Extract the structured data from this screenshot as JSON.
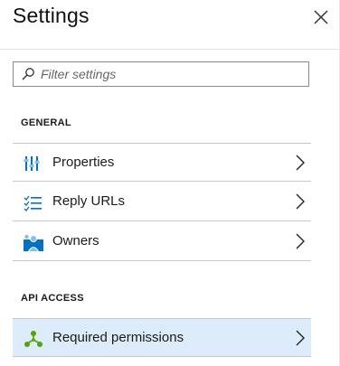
{
  "blade": {
    "title": "Settings",
    "close_icon": "close-icon"
  },
  "search": {
    "placeholder": "Filter settings",
    "value": ""
  },
  "sections": [
    {
      "header": "GENERAL",
      "items": [
        {
          "label": "Properties",
          "icon": "properties-icon"
        },
        {
          "label": "Reply URLs",
          "icon": "reply-urls-icon"
        },
        {
          "label": "Owners",
          "icon": "owners-icon"
        }
      ]
    },
    {
      "header": "API ACCESS",
      "items": [
        {
          "label": "Required permissions",
          "icon": "required-permissions-icon",
          "selected": true
        }
      ]
    }
  ],
  "colors": {
    "accent": "#0078d7",
    "selected_bg": "#dcecfb",
    "permissions_icon": "#57a300"
  }
}
